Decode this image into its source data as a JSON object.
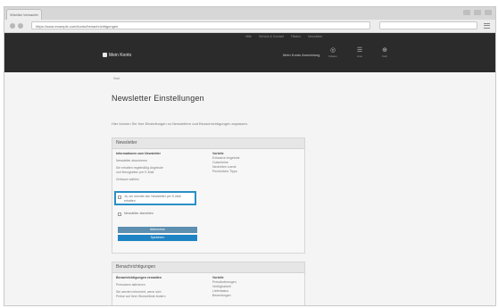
{
  "browser": {
    "tab_title": "Wishlist Verkaufer",
    "url": "https://www.example.com/konto/benachrichtigungen",
    "colors": {
      "chrome": "#d7d7d7",
      "focus_ring": "#2a8fc8"
    }
  },
  "header": {
    "utility_links": [
      "Hilfe",
      "Service & Kontakt",
      "Filialen",
      "Newsletter"
    ],
    "brand": "Mein Konto",
    "account_link": "Mein Konto Anmeldung",
    "icons": [
      {
        "name": "location-icon",
        "caption": "Filialen"
      },
      {
        "name": "list-icon",
        "caption": "Liste"
      },
      {
        "name": "cart-icon",
        "caption": "Korb"
      }
    ],
    "background": "#2b2b2b"
  },
  "breadcrumb": "Start",
  "page": {
    "title": "Newsletter Einstellungen",
    "intro": "Hier können Sie Ihre Einstellungen zu Newslettern und Benachrichtigungen anpassen."
  },
  "sections": [
    {
      "heading": "Newsletter",
      "left_lines": [
        "Informationen zum Newsletter",
        "Newsletter abonnieren",
        "Sie erhalten regelmäßig Angebote",
        "und Neuigkeiten per E-Mail",
        "Zeitraum wählen"
      ],
      "right_title": "Vorteile",
      "right_lines": [
        "Exklusive Angebote",
        "Gutscheine",
        "Neuheiten zuerst",
        "Persönliche Tipps"
      ],
      "highlighted_checkbox": "Ja, ich möchte den Newsletter per E-Mail erhalten",
      "secondary_checkbox": "Newsletter abmelden",
      "secondary_button": "Abbrechen",
      "primary_button": "Speichern"
    },
    {
      "heading": "Benachrichtigungen",
      "left_lines": [
        "Benachrichtigungen verwalten",
        "Preisalarm aktivieren",
        "Sie werden informiert, wenn sich",
        "Preise auf Ihrer Wunschliste ändern"
      ],
      "right_title": "Vorteile",
      "right_lines": [
        "Preisänderungen",
        "Verfügbarkeit",
        "Lieferstatus",
        "Bewertungen"
      ]
    }
  ]
}
